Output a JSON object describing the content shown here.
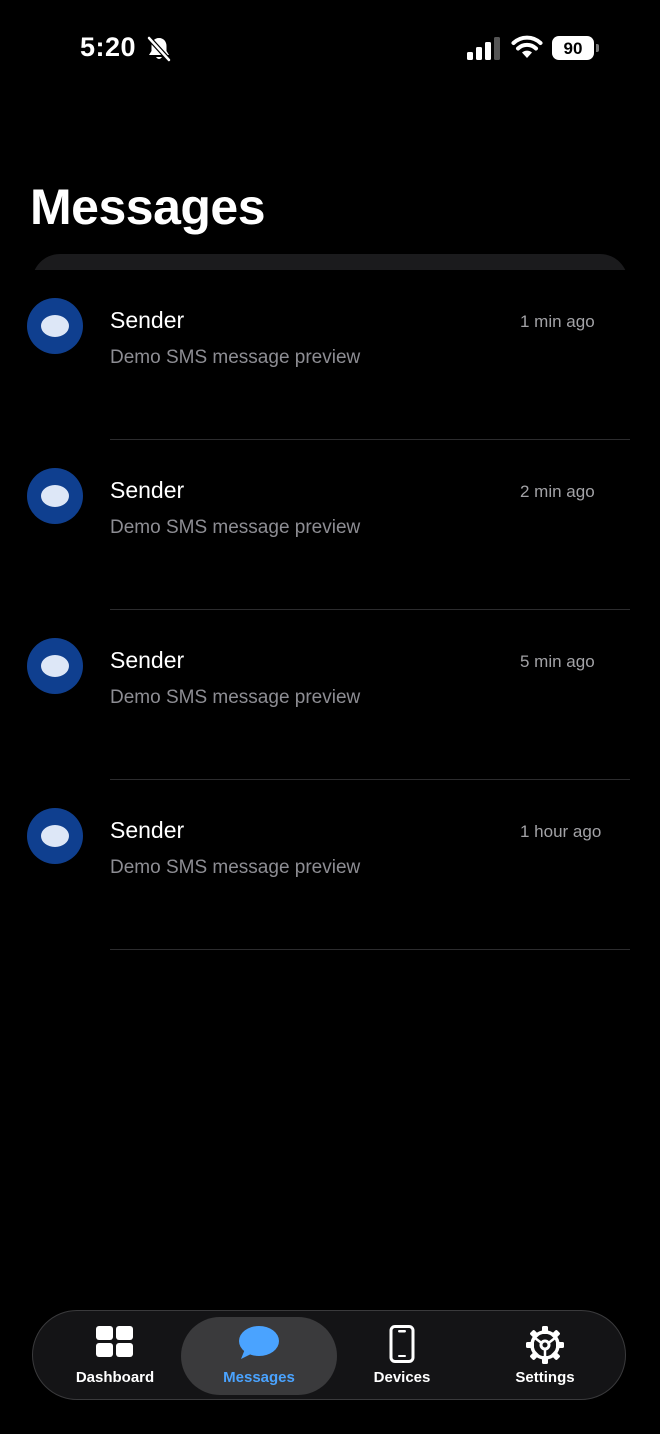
{
  "status_bar": {
    "time": "5:20",
    "battery_level": "90",
    "icons": [
      "bell-slash-icon",
      "cellular-signal-icon",
      "wifi-icon",
      "battery-icon"
    ]
  },
  "page": {
    "title": "Messages"
  },
  "messages": [
    {
      "sender": "Sender",
      "time": "1 min ago",
      "preview": "Demo SMS message preview"
    },
    {
      "sender": "Sender",
      "time": "2 min ago",
      "preview": "Demo SMS message preview"
    },
    {
      "sender": "Sender",
      "time": "5 min ago",
      "preview": "Demo SMS message preview"
    },
    {
      "sender": "Sender",
      "time": "1 hour ago",
      "preview": "Demo SMS message preview"
    }
  ],
  "tab_bar": {
    "active_tab": "Messages",
    "accent_color": "#4aa3ff",
    "tabs": [
      {
        "label": "Dashboard",
        "icon": "dashboard-grid-icon"
      },
      {
        "label": "Messages",
        "icon": "chat-bubble-icon"
      },
      {
        "label": "Devices",
        "icon": "phone-device-icon"
      },
      {
        "label": "Settings",
        "icon": "gear-icon"
      }
    ]
  },
  "colors": {
    "background": "#000000",
    "avatar": "#0f3f8f",
    "secondary_text": "#8d8d93"
  }
}
